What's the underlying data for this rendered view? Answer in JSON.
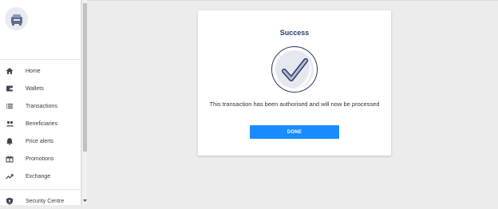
{
  "sidebar": {
    "logo_icon": "bank-safe-icon",
    "items": [
      {
        "label": "Home",
        "icon": "home-icon"
      },
      {
        "label": "Wallets",
        "icon": "wallet-icon"
      },
      {
        "label": "Transactions",
        "icon": "list-icon"
      },
      {
        "label": "Beneficiaries",
        "icon": "people-icon"
      },
      {
        "label": "Price alerts",
        "icon": "bell-icon"
      },
      {
        "label": "Promotions",
        "icon": "gift-icon"
      },
      {
        "label": "Exchange",
        "icon": "trending-up-icon"
      },
      {
        "label": "Security Centre",
        "icon": "shield-icon"
      }
    ]
  },
  "dialog": {
    "title": "Success",
    "icon": "checkmark-circle-icon",
    "message": "This transaction has been authorised and will now be processed",
    "done_label": "DONE"
  },
  "colors": {
    "accent": "#1a8cff",
    "title": "#2b3a6e",
    "background": "#ececec"
  }
}
